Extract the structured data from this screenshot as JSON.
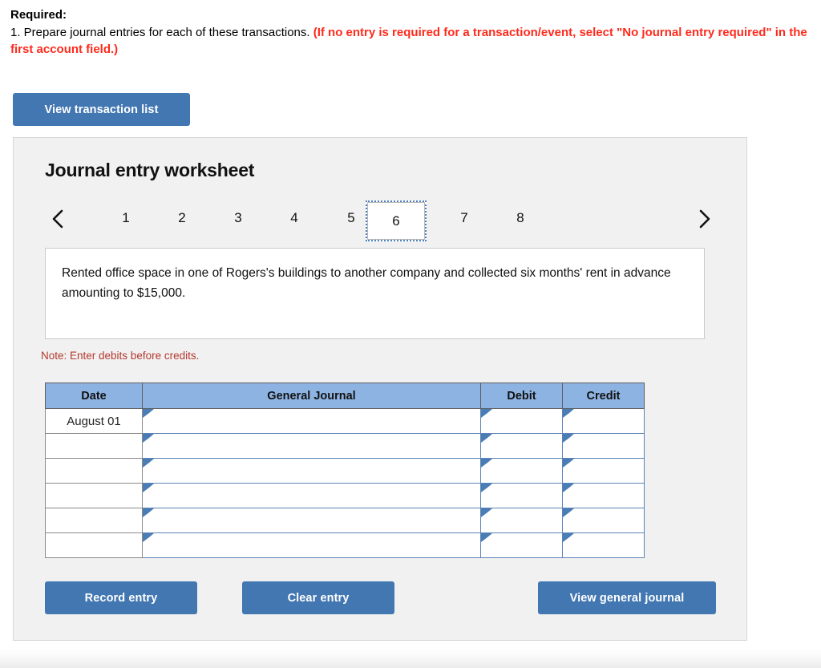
{
  "instructions": {
    "heading": "Required:",
    "line_prefix": "1. Prepare journal entries for each of these transactions. ",
    "line_emphasis": "(If no entry is required for a transaction/event, select \"No journal entry required\" in the first account field.)"
  },
  "toolbar": {
    "view_transaction_list_label": "View transaction list"
  },
  "worksheet": {
    "title": "Journal entry worksheet",
    "prev_icon": "chevron-left-icon",
    "next_icon": "chevron-right-icon",
    "tabs": [
      {
        "label": "1",
        "active": false
      },
      {
        "label": "2",
        "active": false
      },
      {
        "label": "3",
        "active": false
      },
      {
        "label": "4",
        "active": false
      },
      {
        "label": "5",
        "active": false
      },
      {
        "label": "6",
        "active": true
      },
      {
        "label": "7",
        "active": false
      },
      {
        "label": "8",
        "active": false
      }
    ],
    "active_tab": "6",
    "description": "Rented office space in one of Rogers's buildings to another company and collected six months' rent in advance amounting to $15,000.",
    "note": "Note: Enter debits before credits."
  },
  "journal_table": {
    "columns": [
      "Date",
      "General Journal",
      "Debit",
      "Credit"
    ],
    "rows": [
      {
        "date": "August 01",
        "general_journal": "",
        "debit": "",
        "credit": ""
      },
      {
        "date": "",
        "general_journal": "",
        "debit": "",
        "credit": ""
      },
      {
        "date": "",
        "general_journal": "",
        "debit": "",
        "credit": ""
      },
      {
        "date": "",
        "general_journal": "",
        "debit": "",
        "credit": ""
      },
      {
        "date": "",
        "general_journal": "",
        "debit": "",
        "credit": ""
      },
      {
        "date": "",
        "general_journal": "",
        "debit": "",
        "credit": ""
      }
    ]
  },
  "actions": {
    "record_entry_label": "Record entry",
    "clear_entry_label": "Clear entry",
    "view_general_journal_label": "View general journal"
  },
  "colors": {
    "button_blue": "#4277b2",
    "table_header_blue": "#8db3e2",
    "note_red": "#b5392f",
    "emphasis_red": "#ff2a1c",
    "panel_gray": "#f1f1f1",
    "input_border_blue": "#5b84b5"
  }
}
